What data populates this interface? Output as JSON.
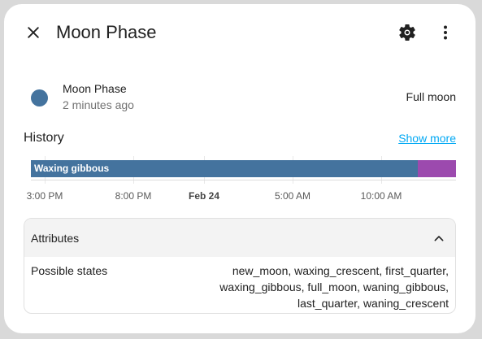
{
  "dialog": {
    "title": "Moon Phase",
    "icons": {
      "close": "close-icon",
      "settings": "gear-icon",
      "menu": "more-vertical-icon"
    }
  },
  "entity": {
    "name": "Moon Phase",
    "last_changed": "2 minutes ago",
    "state": "Full moon",
    "icon_color": "#44739e"
  },
  "history": {
    "title": "History",
    "show_more": "Show more",
    "segments": [
      {
        "label": "Waxing gibbous",
        "color": "#44739e"
      },
      {
        "label": "",
        "color": "#9c4aae"
      }
    ],
    "ticks": [
      "3:00 PM",
      "8:00 PM",
      "Feb 24",
      "5:00 AM",
      "10:00 AM"
    ]
  },
  "attributes": {
    "title": "Attributes",
    "rows": [
      {
        "key": "Possible states",
        "value": "new_moon, waxing_crescent, first_quarter, waxing_gibbous, full_moon, waning_gibbous, last_quarter, waning_crescent"
      }
    ]
  }
}
